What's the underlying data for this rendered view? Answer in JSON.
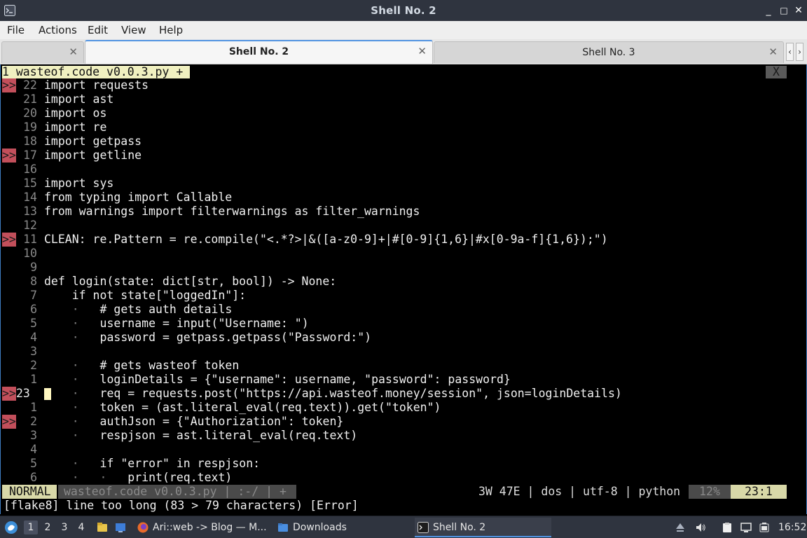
{
  "window": {
    "title": "Shell No. 2",
    "controls": {
      "minimize": "_",
      "maximize": "□",
      "close": "✕"
    }
  },
  "menu": [
    "File",
    "Actions",
    "Edit",
    "View",
    "Help"
  ],
  "tabs": [
    {
      "label": "",
      "active": false
    },
    {
      "label": "Shell No. 2",
      "active": true
    },
    {
      "label": "Shell No. 3",
      "active": false
    }
  ],
  "editor": {
    "buffer_tab": "1 wasteof.code v0.0.3.py +",
    "buffer_close": "X",
    "lines": [
      {
        "num": "22",
        "sign": ">>",
        "text": "import requests"
      },
      {
        "num": "21",
        "sign": "",
        "text": "import ast"
      },
      {
        "num": "20",
        "sign": "",
        "text": "import os"
      },
      {
        "num": "19",
        "sign": "",
        "text": "import re"
      },
      {
        "num": "18",
        "sign": "",
        "text": "import getpass"
      },
      {
        "num": "17",
        "sign": ">>",
        "text": "import getline"
      },
      {
        "num": "16",
        "sign": "",
        "text": ""
      },
      {
        "num": "15",
        "sign": "",
        "text": "import sys"
      },
      {
        "num": "14",
        "sign": "",
        "text": "from typing import Callable"
      },
      {
        "num": "13",
        "sign": "",
        "text": "from warnings import filterwarnings as filter_warnings"
      },
      {
        "num": "12",
        "sign": "",
        "text": ""
      },
      {
        "num": "11",
        "sign": ">>",
        "text": "CLEAN: re.Pattern = re.compile(\"<.*?>|&([a-z0-9]+|#[0-9]{1,6}|#x[0-9a-f]{1,6});\")"
      },
      {
        "num": "10",
        "sign": "",
        "text": ""
      },
      {
        "num": "9",
        "sign": "",
        "text": ""
      },
      {
        "num": "8",
        "sign": "",
        "text": "def login(state: dict[str, bool]) -> None:"
      },
      {
        "num": "7",
        "sign": "",
        "text": "    if not state[\"loggedIn\"]:"
      },
      {
        "num": "6",
        "sign": "",
        "text": "    ·   # gets auth details"
      },
      {
        "num": "5",
        "sign": "",
        "text": "    ·   username = input(\"Username: \")"
      },
      {
        "num": "4",
        "sign": "",
        "text": "    ·   password = getpass.getpass(\"Password:\")"
      },
      {
        "num": "3",
        "sign": "",
        "text": ""
      },
      {
        "num": "2",
        "sign": "",
        "text": "    ·   # gets wasteof token"
      },
      {
        "num": "1",
        "sign": "",
        "text": "    ·   loginDetails = {\"username\": username, \"password\": password}"
      },
      {
        "num": "23",
        "sign": ">>",
        "text": "    ·   req = requests.post(\"https://api.wasteof.money/session\", json=loginDetails)",
        "current": true
      },
      {
        "num": "1",
        "sign": "",
        "text": "    ·   token = (ast.literal_eval(req.text)).get(\"token\")"
      },
      {
        "num": "2",
        "sign": ">>",
        "text": "    ·   authJson = {\"Authorization\": token}"
      },
      {
        "num": "3",
        "sign": "",
        "text": "    ·   respjson = ast.literal_eval(req.text)"
      },
      {
        "num": "4",
        "sign": "",
        "text": ""
      },
      {
        "num": "5",
        "sign": "",
        "text": "    ·   if \"error\" in respjson:"
      },
      {
        "num": "6",
        "sign": "",
        "text": "    ·   ·   print(req.text)"
      }
    ],
    "status": {
      "mode": "NORMAL",
      "file": "wasteof.code v0.0.3.py | :-/ | +",
      "info": "3W 47E | dos | utf-8 | python",
      "percent": "12%",
      "position": "23:1"
    },
    "message": "[flake8] line too long (83 > 79 characters) [Error]"
  },
  "taskbar": {
    "desktops": [
      "1",
      "2",
      "3",
      "4"
    ],
    "tasks": [
      {
        "label": "Ari::web -> Blog — M...",
        "icon": "firefox-icon"
      },
      {
        "label": "Downloads",
        "icon": "folder-icon"
      },
      {
        "label": "Shell No. 2",
        "icon": "terminal-icon",
        "active": true
      }
    ],
    "clock": "16:52"
  }
}
